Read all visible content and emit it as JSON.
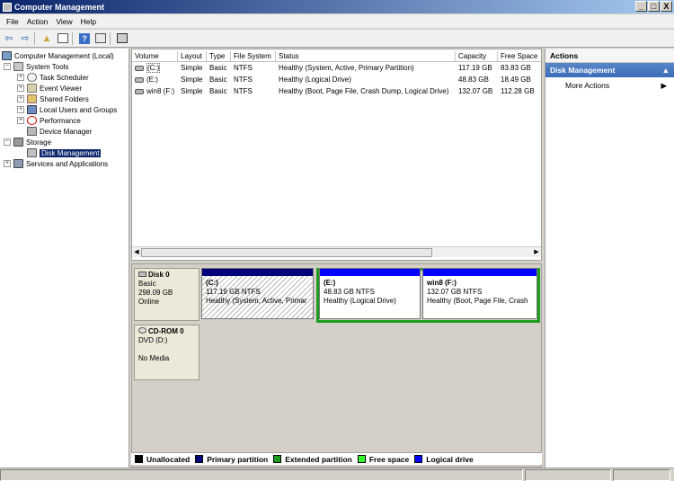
{
  "window": {
    "title": "Computer Management",
    "buttons": [
      "_",
      "□",
      "X"
    ]
  },
  "menu": [
    "File",
    "Action",
    "View",
    "Help"
  ],
  "toolbar": [
    "back-icon",
    "forward-icon",
    "up-folder-icon",
    "show-hide-tree-icon",
    "help-icon",
    "properties-icon"
  ],
  "tree": [
    {
      "label": "Computer Management (Local)",
      "level": 0,
      "expander": "−",
      "icon": "comp"
    },
    {
      "label": "System Tools",
      "level": 1,
      "expander": "−",
      "icon": "tools"
    },
    {
      "label": "Task Scheduler",
      "level": 2,
      "expander": "+",
      "icon": "clock"
    },
    {
      "label": "Event Viewer",
      "level": 2,
      "expander": "+",
      "icon": "event"
    },
    {
      "label": "Shared Folders",
      "level": 2,
      "expander": "+",
      "icon": "share"
    },
    {
      "label": "Local Users and Groups",
      "level": 2,
      "expander": "+",
      "icon": "users"
    },
    {
      "label": "Performance",
      "level": 2,
      "expander": "+",
      "icon": "perf"
    },
    {
      "label": "Device Manager",
      "level": 2,
      "expander": "",
      "icon": "dev"
    },
    {
      "label": "Storage",
      "level": 1,
      "expander": "−",
      "icon": "stor"
    },
    {
      "label": "Disk Management",
      "level": 2,
      "expander": "",
      "icon": "disk",
      "selected": true
    },
    {
      "label": "Services and Applications",
      "level": 1,
      "expander": "+",
      "icon": "svc"
    }
  ],
  "volumes": {
    "columns": [
      "Volume",
      "Layout",
      "Type",
      "File System",
      "Status",
      "Capacity",
      "Free Space"
    ],
    "rows": [
      [
        "(C:)",
        "Simple",
        "Basic",
        "NTFS",
        "Healthy (System, Active, Primary Partition)",
        "117.19 GB",
        "83.83 GB"
      ],
      [
        "(E:)",
        "Simple",
        "Basic",
        "NTFS",
        "Healthy (Logical Drive)",
        "48.83 GB",
        "18.49 GB"
      ],
      [
        "win8 (F:)",
        "Simple",
        "Basic",
        "NTFS",
        "Healthy (Boot, Page File, Crash Dump, Logical Drive)",
        "132.07 GB",
        "112.28 GB"
      ]
    ]
  },
  "disks": [
    {
      "name": "Disk 0",
      "type": "Basic",
      "size": "298.09 GB",
      "state": "Online"
    },
    {
      "name": "CD-ROM 0",
      "type": "DVD (D:)",
      "size": "",
      "state": "No Media"
    }
  ],
  "partitions": [
    {
      "name": "(C:)",
      "size": "117.19 GB NTFS",
      "status": "Healthy (System, Active, Primar",
      "band_color": "#00007c"
    },
    {
      "name": "(E:)",
      "size": "48.83 GB NTFS",
      "status": "Healthy (Logical Drive)",
      "band_color": "#0000ff"
    },
    {
      "name": "win8  (F:)",
      "size": "132.07 GB NTFS",
      "status": "Healthy (Boot, Page File, Crash",
      "band_color": "#0000ff"
    }
  ],
  "legend": [
    {
      "label": "Unallocated",
      "color": "#000000"
    },
    {
      "label": "Primary partition",
      "color": "#00007c"
    },
    {
      "label": "Extended partition",
      "color": "#1e9c1e"
    },
    {
      "label": "Free space",
      "color": "#33ff33"
    },
    {
      "label": "Logical drive",
      "color": "#0000ff"
    }
  ],
  "actions": {
    "header": "Actions",
    "section": "Disk Management",
    "section_arrow": "▲",
    "item": "More Actions",
    "item_arrow": "▶"
  }
}
